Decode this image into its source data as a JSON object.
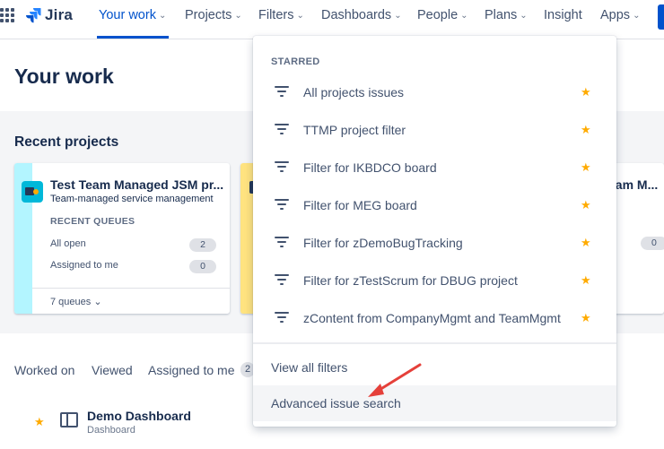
{
  "nav": {
    "logo": "Jira",
    "items": [
      {
        "label": "Your work",
        "chevron": true,
        "active": true
      },
      {
        "label": "Projects",
        "chevron": true
      },
      {
        "label": "Filters",
        "chevron": true
      },
      {
        "label": "Dashboards",
        "chevron": true
      },
      {
        "label": "People",
        "chevron": true
      },
      {
        "label": "Plans",
        "chevron": true
      },
      {
        "label": "Insight",
        "chevron": false
      },
      {
        "label": "Apps",
        "chevron": true
      }
    ]
  },
  "page": {
    "title": "Your work",
    "recent_title": "Recent projects"
  },
  "cards": [
    {
      "title": "Test Team Managed JSM pr...",
      "subtitle": "Team-managed service management",
      "section": "RECENT QUEUES",
      "queues": [
        {
          "label": "All open",
          "count": "2"
        },
        {
          "label": "Assigned to me",
          "count": "0"
        }
      ],
      "footer": "7 queues ⌄",
      "stripe_color": "#B3F5FF"
    },
    {
      "title_fragment": "eam M...",
      "count_fragment": "0",
      "stripe_color": "#FFE380"
    }
  ],
  "tabs": {
    "worked_on": "Worked on",
    "viewed": "Viewed",
    "assigned": "Assigned to me",
    "assigned_count": "2"
  },
  "recent_item": {
    "title": "Demo Dashboard",
    "subtitle": "Dashboard"
  },
  "dropdown": {
    "heading": "STARRED",
    "filters": [
      "All projects issues",
      "TTMP project filter",
      "Filter for IKBDCO board",
      "Filter for MEG board",
      "Filter for zDemoBugTracking",
      "Filter for zTestScrum for DBUG project",
      "zContent from CompanyMgmt and TeamMgmt"
    ],
    "view_all": "View all filters",
    "advanced": "Advanced issue search"
  },
  "colors": {
    "accent": "#0052CC",
    "star": "#FFAB00",
    "annotation_arrow": "#E5403A"
  }
}
